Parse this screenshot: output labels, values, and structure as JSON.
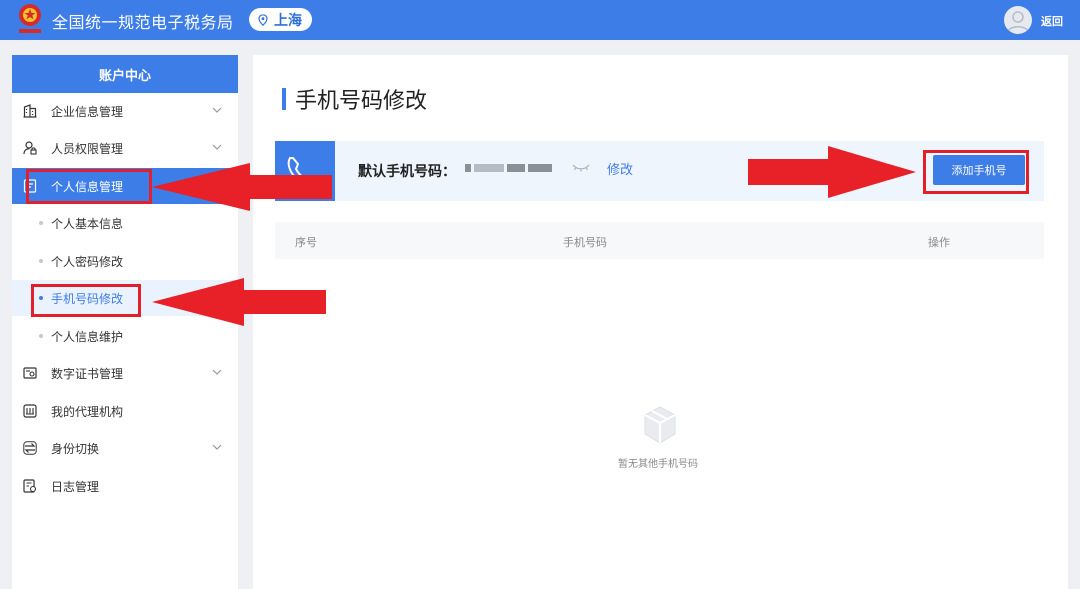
{
  "header": {
    "site_title": "全国统一规范电子税务局",
    "region": "上海",
    "back_label": "返回"
  },
  "sidebar": {
    "title": "账户中心",
    "items": [
      {
        "label": "企业信息管理",
        "icon": "building-icon",
        "expandable": true
      },
      {
        "label": "人员权限管理",
        "icon": "user-lock-icon",
        "expandable": true
      },
      {
        "label": "个人信息管理",
        "icon": "profile-card-icon",
        "expandable": true,
        "active": true
      },
      {
        "label": "数字证书管理",
        "icon": "certificate-icon",
        "expandable": true
      },
      {
        "label": "我的代理机构",
        "icon": "agency-icon",
        "expandable": false
      },
      {
        "label": "身份切换",
        "icon": "switch-icon",
        "expandable": true
      },
      {
        "label": "日志管理",
        "icon": "log-icon",
        "expandable": false
      }
    ],
    "sub_items": [
      {
        "label": "个人基本信息"
      },
      {
        "label": "个人密码修改"
      },
      {
        "label": "手机号码修改",
        "current": true
      },
      {
        "label": "个人信息维护"
      }
    ]
  },
  "main": {
    "page_title": "手机号码修改",
    "default_phone_label": "默认手机号码：",
    "edit_label": "修改",
    "add_button_label": "添加手机号",
    "table_headers": [
      "序号",
      "手机号码",
      "操作"
    ],
    "empty_text": "暂无其他手机号码"
  },
  "colors": {
    "primary": "#3d7de8",
    "highlight": "#e0202a"
  }
}
